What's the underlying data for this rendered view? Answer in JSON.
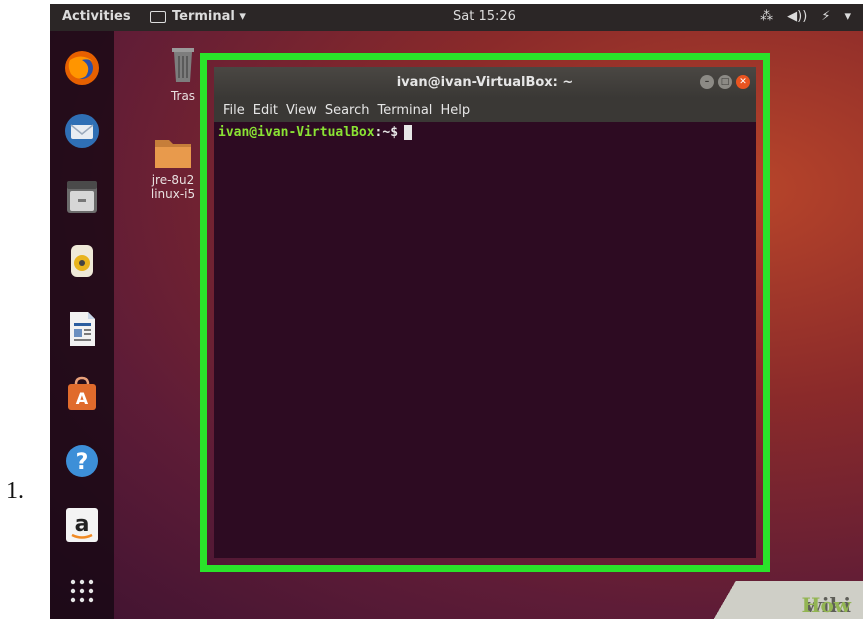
{
  "step_number": "1.",
  "topbar": {
    "activities": "Activities",
    "app_menu": "Terminal ▾",
    "clock": "Sat 15:26",
    "tray": {
      "network": "⁂",
      "volume": "◀))",
      "power": "⚡",
      "menu": "▾"
    }
  },
  "dock": {
    "items": [
      "firefox-icon",
      "thunderbird-icon",
      "files-icon",
      "rhythmbox-icon",
      "writer-icon",
      "software-icon",
      "help-icon",
      "amazon-icon",
      "app-grid-icon"
    ]
  },
  "desktop": {
    "trash_label": "Tras",
    "folder_label_line1": "jre-8u2",
    "folder_label_line2": "linux-i5"
  },
  "terminal": {
    "title": "ivan@ivan-VirtualBox: ~",
    "menu": [
      "File",
      "Edit",
      "View",
      "Search",
      "Terminal",
      "Help"
    ],
    "prompt_user": "ivan@ivan-VirtualBox",
    "prompt_path": ":~$"
  },
  "watermark": {
    "wiki": "wiki",
    "how": "How"
  },
  "colors": {
    "highlight": "#2ae32a",
    "terminal_bg": "#2d0b22",
    "prompt_green": "#8ae234",
    "close_button": "#e95420"
  }
}
